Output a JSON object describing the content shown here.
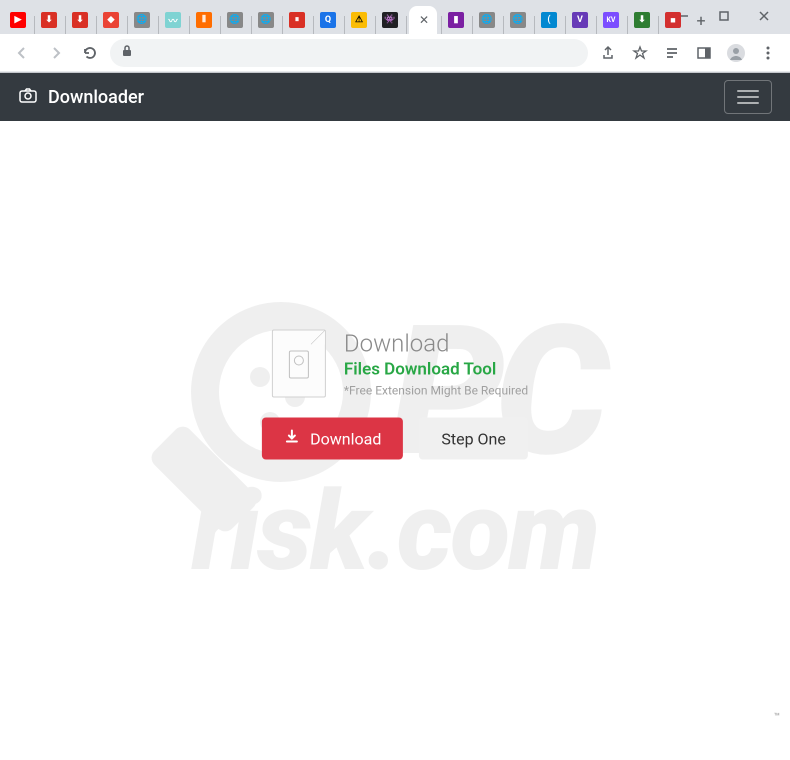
{
  "window": {
    "dropdown_icon": "chevron-down",
    "minimize": "—",
    "maximize": "☐",
    "close": "✕"
  },
  "tabs": {
    "favicons": [
      {
        "bg": "#ff0000",
        "txt": "▶"
      },
      {
        "bg": "#d93025",
        "txt": "⬇"
      },
      {
        "bg": "#d93025",
        "txt": "⬇"
      },
      {
        "bg": "#ea4335",
        "txt": "◆"
      },
      {
        "bg": "#8ab4f8",
        "txt": "🌐"
      },
      {
        "bg": "#7fd3d3",
        "txt": "〰"
      },
      {
        "bg": "#ff6d00",
        "txt": "⦀"
      },
      {
        "bg": "#8ab4f8",
        "txt": "🌐"
      },
      {
        "bg": "#8ab4f8",
        "txt": "🌐"
      },
      {
        "bg": "#d93025",
        "txt": "⏸"
      },
      {
        "bg": "#1a73e8",
        "txt": "Q"
      },
      {
        "bg": "#fbbc04",
        "txt": "⚠"
      },
      {
        "bg": "#202124",
        "txt": "👾"
      }
    ],
    "active_close": "✕",
    "trailing_favicons": [
      {
        "bg": "#7b1fa2",
        "txt": "▮"
      },
      {
        "bg": "#8ab4f8",
        "txt": "🌐"
      },
      {
        "bg": "#8ab4f8",
        "txt": "🌐"
      },
      {
        "bg": "#0288d1",
        "txt": "("
      },
      {
        "bg": "#673ab7",
        "txt": "V"
      },
      {
        "bg": "#7c4dff",
        "txt": "KV"
      },
      {
        "bg": "#2e7d32",
        "txt": "⬇"
      },
      {
        "bg": "#d32f2f",
        "txt": "■"
      }
    ],
    "new_tab": "+"
  },
  "toolbar": {
    "omnibox_value": ""
  },
  "page": {
    "navbar_brand": "Downloader",
    "heading": "Download",
    "subheading": "Files Download Tool",
    "note": "*Free Extension Might Be Required",
    "download_button": "Download",
    "step_button": "Step One"
  },
  "watermark": {
    "pc": "PC",
    "bottom": "risk.com",
    "tm": "™"
  }
}
